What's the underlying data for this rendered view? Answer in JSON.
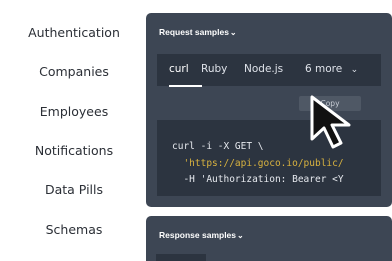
{
  "sidebar": {
    "items": [
      {
        "label": "Authentication"
      },
      {
        "label": "Companies"
      },
      {
        "label": "Employees"
      },
      {
        "label": "Notifications"
      },
      {
        "label": "Data Pills"
      },
      {
        "label": "Schemas"
      }
    ]
  },
  "request_panel": {
    "title": "Request samples",
    "tabs": [
      "curl",
      "Ruby",
      "Node.js",
      "6 more"
    ],
    "active_tab": "curl",
    "copy_label": "Copy",
    "code_lines": [
      "curl -i -X GET \\",
      "  'https://api.goco.io/public/",
      "  -H 'Authorization: Bearer <Y"
    ]
  },
  "response_panel": {
    "title": "Response samples"
  },
  "colors": {
    "panel": "#3d4654",
    "code_background": "#2c3440",
    "string": "#d8b23f"
  },
  "icons": {
    "expand": "chevron-down-icon",
    "pointer": "mouse-cursor-icon"
  }
}
